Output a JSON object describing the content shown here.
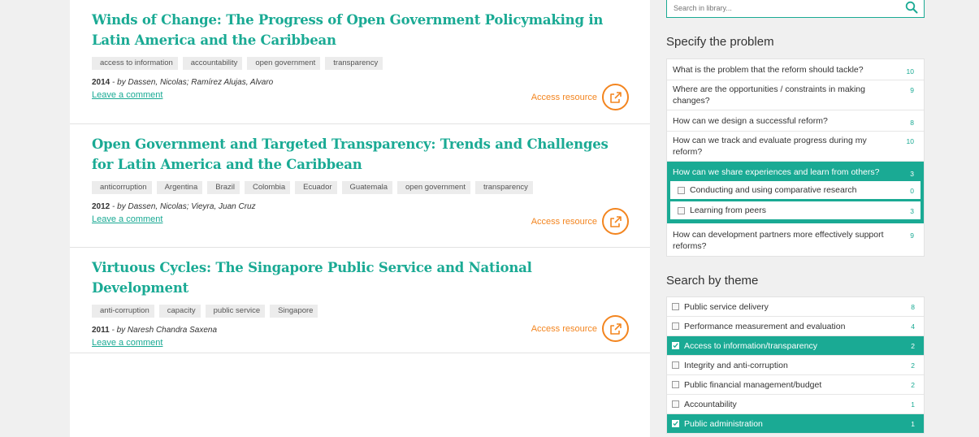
{
  "entries": [
    {
      "title": "Winds of Change: The Progress of Open Government Policymaking in Latin America and the Caribbean",
      "tags": [
        "access to information",
        "accountability",
        "open government",
        "transparency"
      ],
      "year": "2014",
      "authors": "- by Dassen, Nicolas; Ramírez Alujas, Alvaro",
      "comment": "Leave a comment",
      "access": "Access resource"
    },
    {
      "title": "Open Government and Targeted Transparency: Trends and Challenges for Latin America and the Caribbean",
      "tags": [
        "anticorruption",
        "Argentina",
        "Brazil",
        "Colombia",
        "Ecuador",
        "Guatemala",
        "open government",
        "transparency"
      ],
      "year": "2012",
      "authors": "- by Dassen, Nicolas; Vieyra, Juan Cruz",
      "comment": "Leave a comment",
      "access": "Access resource"
    },
    {
      "title": "Virtuous Cycles: The Singapore Public Service and National Development",
      "tags": [
        "anti-corruption",
        "capacity",
        "public service",
        "Singapore"
      ],
      "year": "2011",
      "authors": "- by Naresh Chandra Saxena",
      "comment": "Leave a comment",
      "access": "Access resource"
    }
  ],
  "search": {
    "placeholder": "Search in library..."
  },
  "problem": {
    "heading": "Specify the problem",
    "items": [
      {
        "label": "What is the problem that the reform should tackle?",
        "count": "10"
      },
      {
        "label": "Where are the opportunities / constraints in making changes?",
        "count": "9"
      },
      {
        "label": "How can we design a successful reform?",
        "count": "8"
      },
      {
        "label": "How can we track and evaluate progress during my reform?",
        "count": "10"
      },
      {
        "label": "How can we share experiences and learn from others?",
        "count": "3"
      },
      {
        "label": "How can development partners more effectively support reforms?",
        "count": "9"
      }
    ],
    "subitems": [
      {
        "label": "Conducting and using comparative research",
        "count": "0"
      },
      {
        "label": "Learning from peers",
        "count": "3"
      }
    ]
  },
  "theme": {
    "heading": "Search by theme",
    "items": [
      {
        "label": "Public service delivery",
        "count": "8"
      },
      {
        "label": "Performance measurement and evaluation",
        "count": "4"
      },
      {
        "label": "Access to information/transparency",
        "count": "2"
      },
      {
        "label": "Integrity and anti-corruption",
        "count": "2"
      },
      {
        "label": "Public financial management/budget",
        "count": "2"
      },
      {
        "label": "Accountability",
        "count": "1"
      },
      {
        "label": "Public administration",
        "count": "1"
      }
    ]
  },
  "colors": {
    "accent": "#1aaa94",
    "orange": "#f3851f"
  }
}
